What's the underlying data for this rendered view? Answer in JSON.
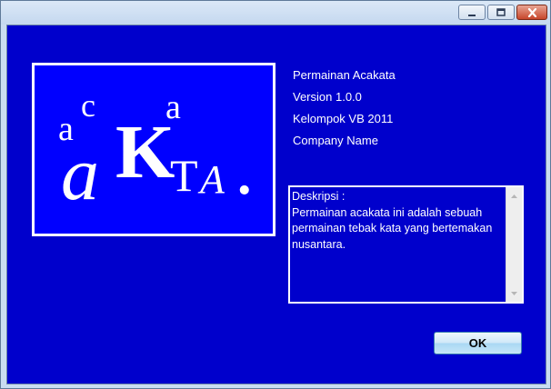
{
  "window": {
    "controls": {
      "minimize_icon": "minimize-icon",
      "maximize_icon": "maximize-icon",
      "close_icon": "close-icon"
    }
  },
  "logo": {
    "small_a": "a",
    "small_c": "c",
    "small_a2": "a",
    "big_a": "a",
    "big_K": "K",
    "big_T": "T",
    "big_A": "A",
    "dot": "."
  },
  "info": {
    "product_name": "Permainan Acakata",
    "version": "Version 1.0.0",
    "copyright": "Kelompok VB 2011",
    "company": "Company Name"
  },
  "description": {
    "text": "Deskripsi :\nPermainan acakata ini adalah sebuah permainan tebak kata yang bertemakan nusantara."
  },
  "buttons": {
    "ok": "OK"
  },
  "colors": {
    "background": "#0000CC",
    "logo_background": "#0000FF",
    "text": "#FFFFFF"
  }
}
